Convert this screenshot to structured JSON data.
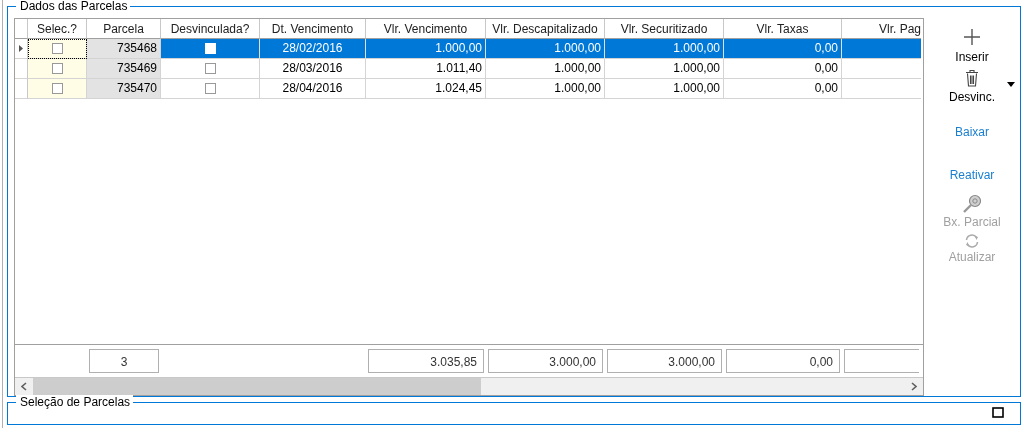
{
  "group": {
    "title": "Dados das Parcelas"
  },
  "table": {
    "columns": [
      "Selec.?",
      "Parcela",
      "Desvinculada?",
      "Dt. Vencimento",
      "Vlr. Vencimento",
      "Vlr. Descapitalizado",
      "Vlr. Securitizado",
      "Vlr. Taxas",
      "Vlr. Pag"
    ],
    "rows": [
      {
        "selected": true,
        "selec_checked": false,
        "parcela": "735468",
        "desvinculada_checked": false,
        "vencimento": "28/02/2016",
        "vlr_vencimento": "1.000,00",
        "vlr_descapitalizado": "1.000,00",
        "vlr_securitizado": "1.000,00",
        "vlr_taxas": "0,00"
      },
      {
        "selected": false,
        "selec_checked": false,
        "parcela": "735469",
        "desvinculada_checked": false,
        "vencimento": "28/03/2016",
        "vlr_vencimento": "1.011,40",
        "vlr_descapitalizado": "1.000,00",
        "vlr_securitizado": "1.000,00",
        "vlr_taxas": "0,00"
      },
      {
        "selected": false,
        "selec_checked": false,
        "parcela": "735470",
        "desvinculada_checked": false,
        "vencimento": "28/04/2016",
        "vlr_vencimento": "1.024,45",
        "vlr_descapitalizado": "1.000,00",
        "vlr_securitizado": "1.000,00",
        "vlr_taxas": "0,00"
      }
    ],
    "totals": [
      {
        "kind": "none"
      },
      {
        "kind": "box",
        "value": "3"
      },
      {
        "kind": "none"
      },
      {
        "kind": "none"
      },
      {
        "kind": "box",
        "value": "3.035,85"
      },
      {
        "kind": "box",
        "value": "3.000,00"
      },
      {
        "kind": "box",
        "value": "3.000,00"
      },
      {
        "kind": "box",
        "value": "0,00"
      },
      {
        "kind": "box"
      }
    ]
  },
  "toolbar": [
    {
      "kind": "add",
      "label": "Inserir",
      "disabled": false,
      "dropdown": false
    },
    {
      "kind": "unlink",
      "label": "Desvinc.",
      "disabled": false,
      "dropdown": true
    },
    {
      "kind": "link",
      "label": "Baixar",
      "disabled": false,
      "dropdown": false
    },
    {
      "kind": "link",
      "label": "Reativar",
      "disabled": false,
      "dropdown": false
    },
    {
      "kind": "partial",
      "label": "Bx. Parcial",
      "disabled": true,
      "dropdown": false
    },
    {
      "kind": "refresh",
      "label": "Atualizar",
      "disabled": true,
      "dropdown": false
    }
  ],
  "selection_group": {
    "title": "Seleção de Parcelas"
  }
}
